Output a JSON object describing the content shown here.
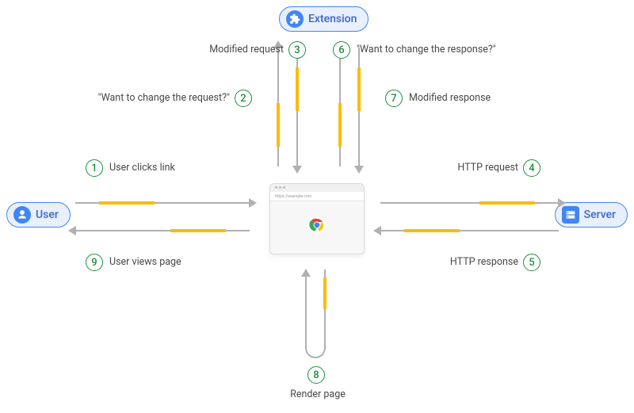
{
  "nodes": {
    "user": "User",
    "extension": "Extension",
    "server": "Server"
  },
  "browser": {
    "address": "https://example.com"
  },
  "steps": {
    "s1": {
      "num": "1",
      "label": "User clicks link"
    },
    "s2": {
      "num": "2",
      "label": "\"Want to change the request?\""
    },
    "s3": {
      "num": "3",
      "label": "Modified request"
    },
    "s4": {
      "num": "4",
      "label": "HTTP request"
    },
    "s5": {
      "num": "5",
      "label": "HTTP response"
    },
    "s6": {
      "num": "6",
      "label": "\"Want to change the response?\""
    },
    "s7": {
      "num": "7",
      "label": "Modified response"
    },
    "s8": {
      "num": "8",
      "label": "Render page"
    },
    "s9": {
      "num": "9",
      "label": "User views page"
    }
  }
}
